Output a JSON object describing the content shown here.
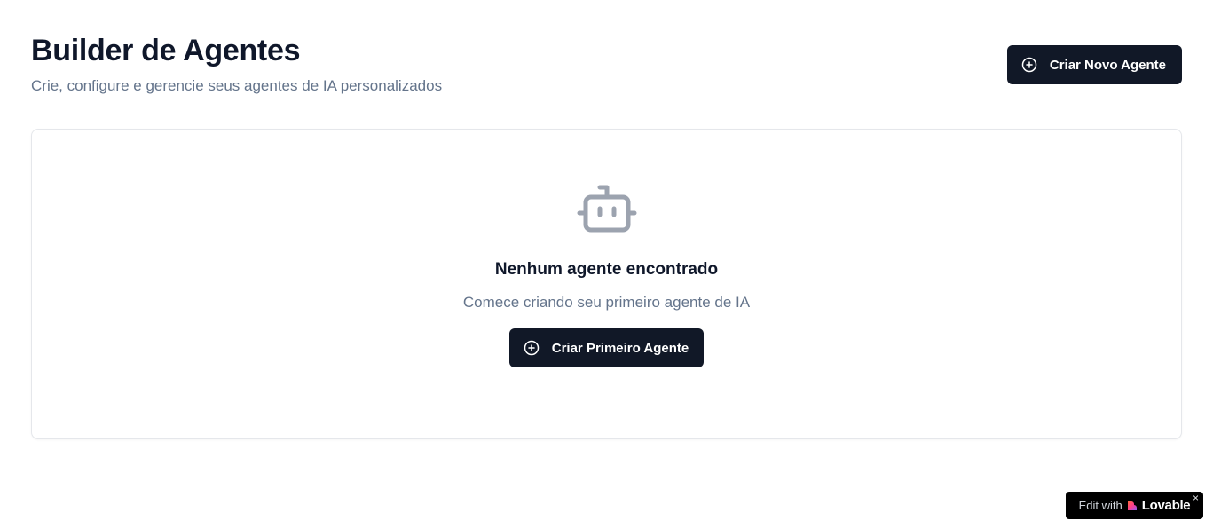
{
  "header": {
    "title": "Builder de Agentes",
    "subtitle": "Crie, configure e gerencie seus agentes de IA personalizados",
    "create_button_label": "Criar Novo Agente"
  },
  "empty_state": {
    "icon": "robot-icon",
    "title": "Nenhum agente encontrado",
    "description": "Comece criando seu primeiro agente de IA",
    "button_label": "Criar Primeiro Agente"
  },
  "badge": {
    "prefix": "Edit with",
    "brand": "Lovable",
    "close": "×"
  },
  "colors": {
    "primary_button": "#111827",
    "muted_text": "#64748b",
    "icon_gray": "#9ca3af"
  }
}
